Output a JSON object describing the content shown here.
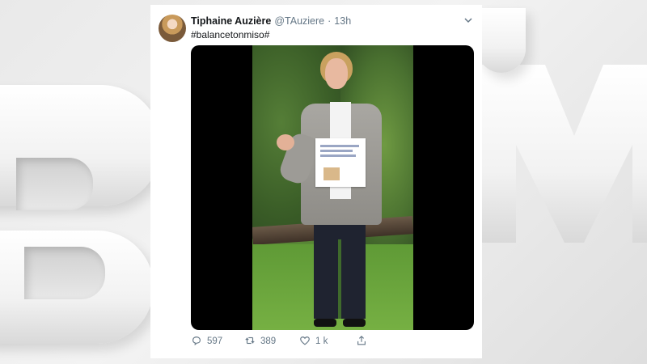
{
  "tweet": {
    "author_name": "Tiphaine Auzière",
    "author_handle": "@TAuziere",
    "separator": "·",
    "time": "13h",
    "text": "#balancetonmiso#",
    "media": {
      "type": "video"
    }
  },
  "actions": {
    "replies": "597",
    "retweets": "389",
    "likes": "1 k"
  },
  "icons": {
    "reply": "reply-icon",
    "retweet": "retweet-icon",
    "like": "heart-icon",
    "share": "share-icon",
    "menu": "chevron-down-icon"
  },
  "colors": {
    "text_primary": "#14171a",
    "text_secondary": "#657786",
    "background": "#ffffff"
  }
}
